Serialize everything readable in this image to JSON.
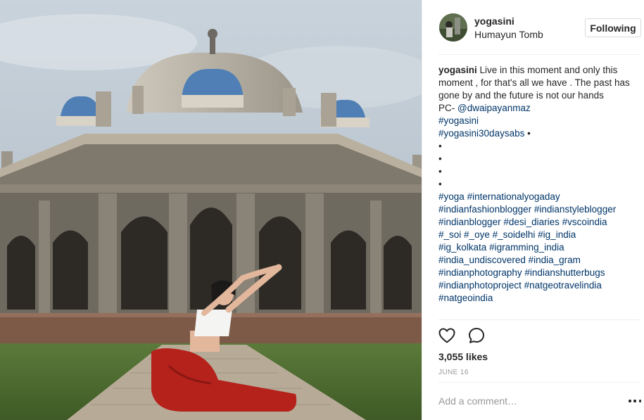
{
  "post": {
    "photo_icon": "yoga-pose-photo",
    "header": {
      "username": "yogasini",
      "location": "Humayun Tomb",
      "follow_label": "Following"
    },
    "caption": {
      "username": "yogasini",
      "text": "Live in this moment and only this moment , for that's all we have . The past has gone by and the future is not our hands",
      "credit_prefix": "PC- ",
      "credit_handle": "@dwaipayanmaz",
      "line_tag1": "#yogasini",
      "line_tag2": "#yogasini30daysabs",
      "bullet": "•",
      "hashtag_lines": [
        [
          "#yoga",
          "#internationalyogaday"
        ],
        [
          "#indianfashionblogger",
          "#indianstyleblogger"
        ],
        [
          "#indianblogger",
          "#desi_diaries",
          "#vscoindia"
        ],
        [
          "#_soi",
          "#_oye",
          "#_soidelhi",
          "#ig_india"
        ],
        [
          "#ig_kolkata",
          "#igramming_india"
        ],
        [
          "#india_undiscovered",
          "#india_gram"
        ],
        [
          "#indianphotography",
          "#indianshutterbugs"
        ],
        [
          "#indianphotoproject",
          "#natgeotravelindia"
        ],
        [
          "#natgeoindia"
        ]
      ]
    },
    "actions": {
      "like_icon": "heart-icon",
      "comment_icon": "comment-bubble-icon"
    },
    "likes_text": "3,055 likes",
    "date_text": "JUNE 16",
    "comment_placeholder": "Add a comment…",
    "more_icon": "more-options-icon",
    "colors": {
      "hashtag": "#003569",
      "text": "#262626",
      "muted": "#999999",
      "border": "#dbdbdb"
    }
  }
}
